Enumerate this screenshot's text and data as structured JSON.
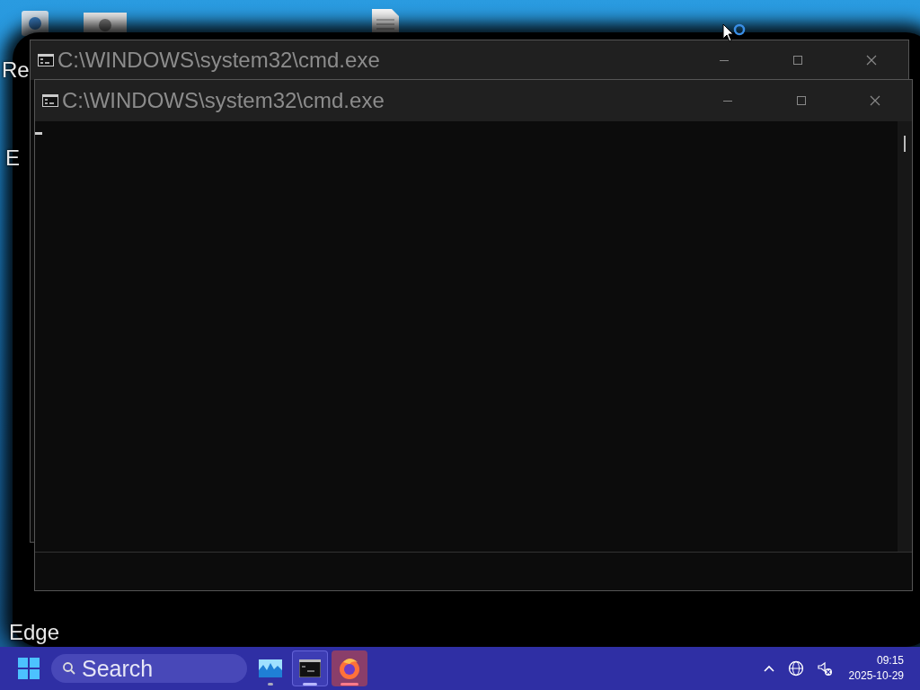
{
  "desktop": {
    "icon_labels": [
      {
        "text": "Re"
      },
      {
        "text": "E"
      },
      {
        "text": "Edge"
      }
    ]
  },
  "windows": [
    {
      "title": "C:\\WINDOWS\\system32\\cmd.exe"
    },
    {
      "title": "C:\\WINDOWS\\system32\\cmd.exe"
    }
  ],
  "taskbar": {
    "search": {
      "placeholder": "Search"
    },
    "apps": [
      {
        "kind": "monitor",
        "selected": false,
        "attention": false
      },
      {
        "kind": "terminal",
        "selected": true,
        "attention": false
      },
      {
        "kind": "browser",
        "selected": false,
        "attention": true
      }
    ],
    "tray": {
      "time": "09:15",
      "date": "2025-10-29"
    }
  }
}
